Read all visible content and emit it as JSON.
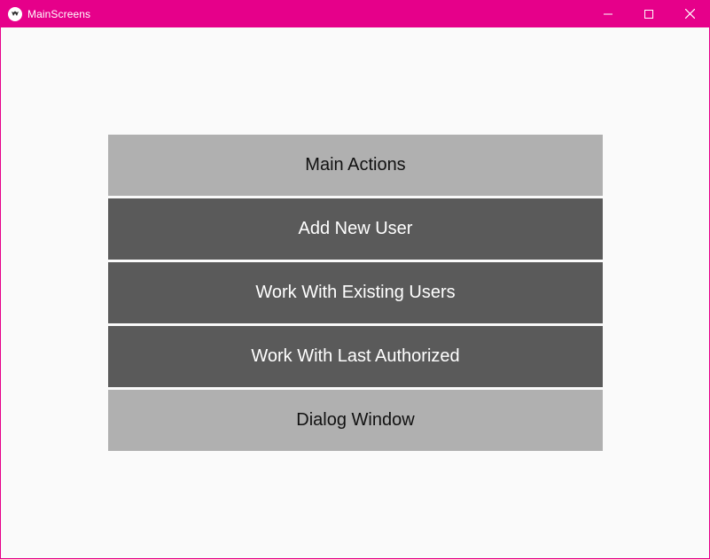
{
  "window": {
    "title": "MainScreens",
    "accent_color": "#e6008a",
    "background_color": "#fafafa",
    "controls": {
      "minimize_icon": "minimize-icon",
      "maximize_icon": "maximize-icon",
      "close_icon": "close-icon"
    }
  },
  "menu": {
    "items": [
      {
        "label": "Main Actions",
        "style": "light"
      },
      {
        "label": "Add New User",
        "style": "dark"
      },
      {
        "label": "Work With Existing Users",
        "style": "dark"
      },
      {
        "label": "Work With Last Authorized",
        "style": "dark"
      },
      {
        "label": "Dialog Window",
        "style": "light"
      }
    ],
    "colors": {
      "light": "#b0b0b0",
      "dark": "#5a5a5a"
    }
  }
}
